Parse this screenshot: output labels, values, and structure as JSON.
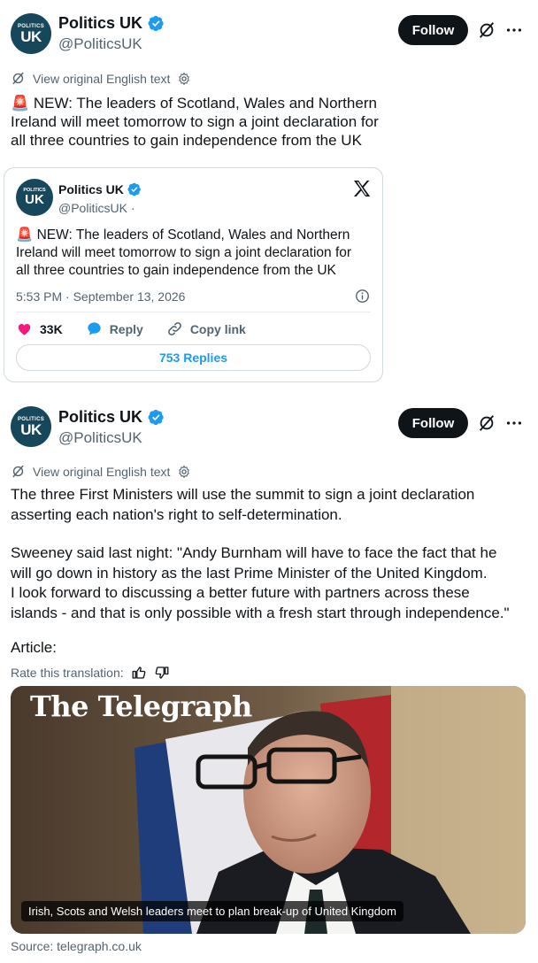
{
  "post1": {
    "avatar": {
      "top_text": "POLITICS",
      "main_text": "UK"
    },
    "display_name": "Politics UK",
    "handle": "@PoliticsUK",
    "follow_label": "Follow",
    "translate_label": "View original English text",
    "text_lines": [
      "🚨 NEW: The leaders of Scotland, Wales and Northern",
      "Ireland will meet tomorrow to sign a joint declaration for",
      "all three countries to gain independence from the UK"
    ]
  },
  "quote": {
    "avatar": {
      "top_text": "POLITICS",
      "main_text": "UK"
    },
    "display_name": "Politics UK",
    "handle": "@PoliticsUK ·",
    "text_lines": [
      "🚨 NEW: The leaders of Scotland, Wales and Northern",
      "Ireland will meet tomorrow to sign a joint declaration for",
      "all three countries to gain independence from the UK"
    ],
    "timestamp": "5:53 PM · September 13, 2026",
    "likes": "33K",
    "reply_label": "Reply",
    "copy_link_label": "Copy link",
    "replies_label": "753 Replies"
  },
  "post2": {
    "avatar": {
      "top_text": "POLITICS",
      "main_text": "UK"
    },
    "display_name": "Politics UK",
    "handle": "@PoliticsUK",
    "follow_label": "Follow",
    "translate_label": "View original English text",
    "para1_lines": [
      "The three First Ministers will use the summit to sign a joint declaration",
      "asserting each nation's right to self-determination."
    ],
    "para2_lines": [
      "Sweeney said last night: \"Andy Burnham will have to face the fact that he",
      "will go down in history as the last Prime Minister of the United Kingdom.",
      "I look forward to discussing a better future with partners across these",
      "islands - and that is only possible with a fresh start through independence.\""
    ],
    "article_label": "Article:",
    "rate_label": "Rate this translation:",
    "article": {
      "masthead": "The Telegraph",
      "caption": "Irish, Scots and Welsh leaders meet to plan break-up of United Kingdom",
      "source": "Source: telegraph.co.uk"
    }
  },
  "colors": {
    "accent_blue": "#1d9bf0",
    "like_pink": "#f91880",
    "avatar_bg": "#16475a",
    "text_primary": "#0f1419",
    "text_secondary": "#536471"
  }
}
